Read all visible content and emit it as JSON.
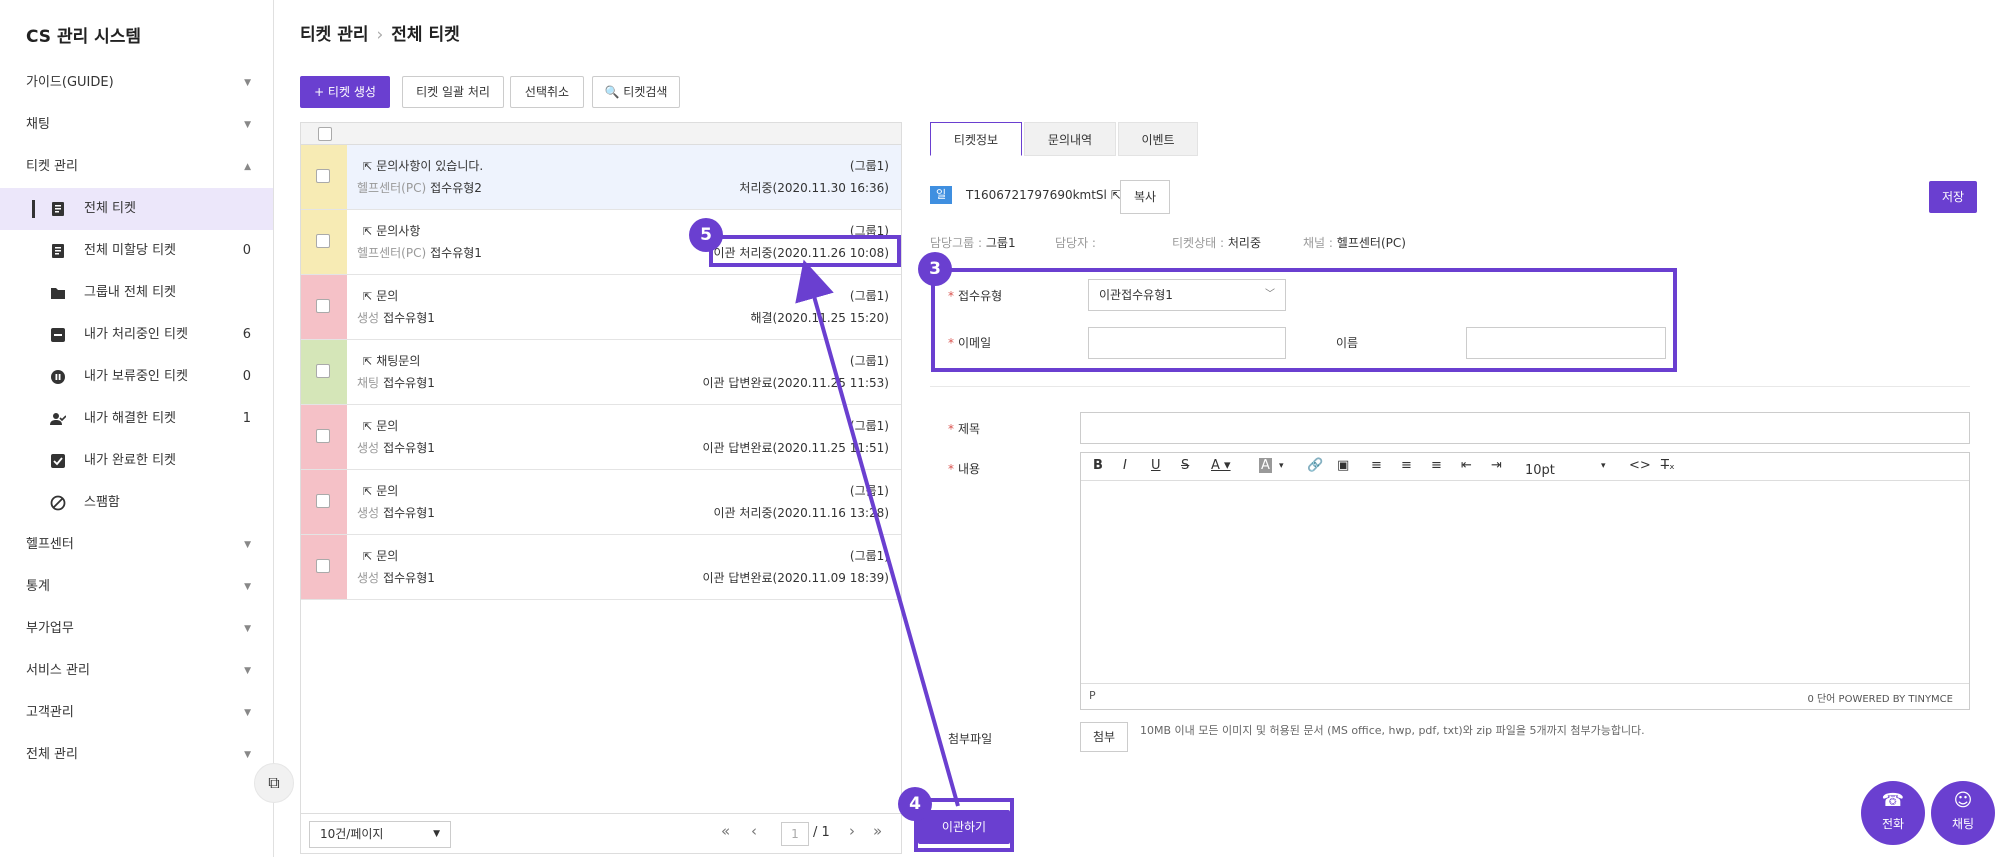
{
  "app": {
    "title": "CS 관리 시스템"
  },
  "sidebar": {
    "items": [
      {
        "label": "가이드(GUIDE)",
        "caret": "▼"
      },
      {
        "label": "채팅",
        "caret": "▼"
      },
      {
        "label": "티켓 관리",
        "caret": "▲"
      }
    ],
    "sub_items": [
      {
        "label": "전체 티켓",
        "count": "",
        "icon": "document-icon"
      },
      {
        "label": "전체 미할당 티켓",
        "count": "0",
        "icon": "document-icon"
      },
      {
        "label": "그룹내 전체 티켓",
        "count": "",
        "icon": "folder-icon"
      },
      {
        "label": "내가 처리중인 티켓",
        "count": "6",
        "icon": "dots-icon"
      },
      {
        "label": "내가 보류중인 티켓",
        "count": "0",
        "icon": "pause-icon"
      },
      {
        "label": "내가 해결한 티켓",
        "count": "1",
        "icon": "user-check-icon"
      },
      {
        "label": "내가 완료한 티켓",
        "count": "",
        "icon": "checkbox-icon"
      },
      {
        "label": "스팸함",
        "count": "",
        "icon": "block-icon"
      }
    ],
    "bottom_items": [
      {
        "label": "헬프센터",
        "caret": "▼"
      },
      {
        "label": "통계",
        "caret": "▼"
      },
      {
        "label": "부가업무",
        "caret": "▼"
      },
      {
        "label": "서비스 관리",
        "caret": "▼"
      },
      {
        "label": "고객관리",
        "caret": "▼"
      },
      {
        "label": "전체 관리",
        "caret": "▼"
      }
    ],
    "collapse_icon": "⧉"
  },
  "breadcrumb": {
    "parent": "티켓 관리",
    "sep": "›",
    "current": "전체 티켓"
  },
  "toolbar": {
    "create": "+ 티켓 생성",
    "bulk": "티켓 일괄 처리",
    "deselect": "선택취소",
    "search": "🔍 티켓검색"
  },
  "tickets": [
    {
      "title": "문의사항이 있습니다.",
      "channel": "헬프센터(PC)",
      "type": "접수유형2",
      "group": "(그룹1)",
      "status": "처리중(2020.11.30 16:36)",
      "color": "#f7ebb4"
    },
    {
      "title": "문의사항",
      "channel": "헬프센터(PC)",
      "type": "접수유형1",
      "group": "(그룹1)",
      "status": "이관 처리중(2020.11.26 10:08)",
      "color": "#f7ebb4"
    },
    {
      "title": "문의",
      "channel": "생성",
      "type": "접수유형1",
      "group": "(그룹1)",
      "status": "해결(2020.11.25 15:20)",
      "color": "#f5c1c7"
    },
    {
      "title": "채팅문의",
      "channel": "채팅",
      "type": "접수유형1",
      "group": "(그룹1)",
      "status": "이관 답변완료(2020.11.25 11:53)",
      "color": "#d5e6b8"
    },
    {
      "title": "문의",
      "channel": "생성",
      "type": "접수유형1",
      "group": "(그룹1)",
      "status": "이관 답변완료(2020.11.25 11:51)",
      "color": "#f5c1c7"
    },
    {
      "title": "문의",
      "channel": "생성",
      "type": "접수유형1",
      "group": "(그룹1)",
      "status": "이관 처리중(2020.11.16 13:28)",
      "color": "#f5c1c7"
    },
    {
      "title": "문의",
      "channel": "생성",
      "type": "접수유형1",
      "group": "(그룹1)",
      "status": "이관 답변완료(2020.11.09 18:39)",
      "color": "#f5c1c7"
    }
  ],
  "pager": {
    "per_page": "10건/페이지",
    "current": "1",
    "total": "/ 1"
  },
  "detail": {
    "tabs": [
      "티켓정보",
      "문의내역",
      "이벤트"
    ],
    "badge": "일반",
    "ticket_id": "T1606721797690kmtSl",
    "copy": "복사",
    "save": "저장",
    "meta": {
      "group_label": "담당그룹 :",
      "group_value": "그룹1",
      "assignee_label": "담당자 :",
      "assignee_value": "",
      "state_label": "티켓상태 :",
      "state_value": "처리중",
      "channel_label": "채널 :",
      "channel_value": "헬프센터(PC)"
    },
    "form": {
      "type_label": "접수유형",
      "type_value": "이관접수유형1",
      "email_label": "이메일",
      "email_value": "",
      "name_label": "이름",
      "name_value": "",
      "subject_label": "제목",
      "subject_value": "",
      "content_label": "내용",
      "attach_label": "첨부파일",
      "attach_btn": "첨부",
      "attach_note": "10MB 이내 모든 이미지 및 허용된 문서 (MS office, hwp, pdf, txt)와 zip 파일을 5개까지 첨부가능합니다.",
      "required_mark": "*"
    },
    "editor": {
      "font_size": "10pt",
      "status_p": "P",
      "word_count": "0 단어  POWERED BY TINYMCE"
    },
    "transfer": "이관하기"
  },
  "fabs": [
    {
      "label": "전화",
      "icon": "☎"
    },
    {
      "label": "채팅",
      "icon": "☺"
    }
  ],
  "markers": [
    "3",
    "4",
    "5"
  ],
  "colors": {
    "accent": "#6a3fd0",
    "badge": "#3f8fe0"
  }
}
